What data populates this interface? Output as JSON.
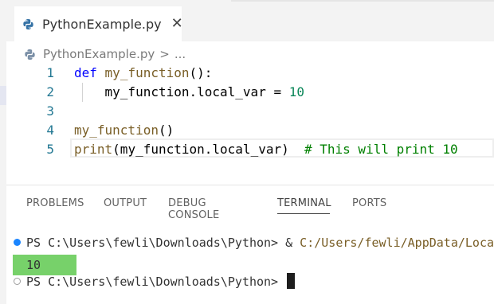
{
  "tab": {
    "label": "PythonExample.py",
    "close_glyph": "✕"
  },
  "breadcrumb": {
    "file": "PythonExample.py",
    "separator": ">",
    "more": "..."
  },
  "editor": {
    "lines": [
      {
        "num": "1",
        "parts": [
          {
            "t": "def",
            "c": "kw"
          },
          {
            "t": " ",
            "c": ""
          },
          {
            "t": "my_function",
            "c": "fn"
          },
          {
            "t": "():",
            "c": ""
          }
        ]
      },
      {
        "num": "2",
        "parts": [
          {
            "t": "    my_function.local_var = ",
            "c": ""
          },
          {
            "t": "10",
            "c": "num"
          }
        ]
      },
      {
        "num": "3",
        "parts": []
      },
      {
        "num": "4",
        "parts": [
          {
            "t": "my_function",
            "c": "fn"
          },
          {
            "t": "()",
            "c": ""
          }
        ]
      },
      {
        "num": "5",
        "parts": [
          {
            "t": "print",
            "c": "fn"
          },
          {
            "t": "(my_function.local_var)  ",
            "c": ""
          },
          {
            "t": "# This will print 10",
            "c": "cm"
          }
        ]
      }
    ]
  },
  "panel": {
    "tabs": [
      {
        "label": "PROBLEMS"
      },
      {
        "label": "OUTPUT"
      },
      {
        "label": "DEBUG CONSOLE"
      },
      {
        "label": "TERMINAL",
        "active": true
      },
      {
        "label": "PORTS"
      }
    ]
  },
  "terminal": {
    "prompt1": "PS C:\\Users\\fewli\\Downloads\\Python> ",
    "cmd_amp": "& ",
    "cmd_path": "C:/Users/fewli/AppData/Local",
    "output": "10",
    "prompt2": "PS C:\\Users\\fewli\\Downloads\\Python> "
  },
  "colors": {
    "keyword": "#0000ff",
    "function": "#795e26",
    "number": "#098658",
    "comment": "#008000",
    "line_number": "#237893",
    "output_highlight": "#77d16a"
  }
}
